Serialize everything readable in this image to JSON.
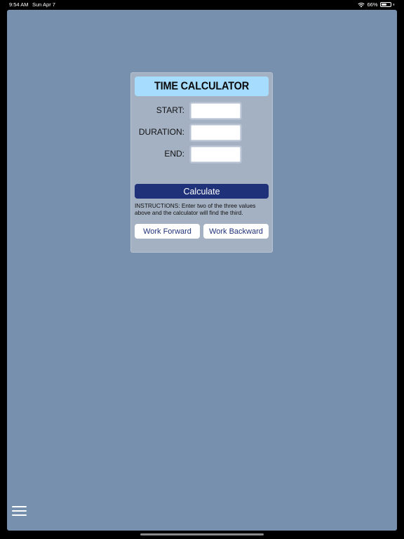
{
  "status_bar": {
    "time": "9:54 AM",
    "date": "Sun Apr 7",
    "battery_text": "66%",
    "battery_level": 0.66,
    "icons": [
      "wifi-icon",
      "battery-icon"
    ]
  },
  "colors": {
    "screen_background": "#7790ad",
    "panel_background": "#a4b1c3",
    "header_background": "#a6dcfd",
    "primary_button": "#1f3178"
  },
  "calculator": {
    "title": "TIME CALCULATOR",
    "fields": [
      {
        "label": "START:",
        "value": "",
        "placeholder": ""
      },
      {
        "label": "DURATION:",
        "value": "",
        "placeholder": ""
      },
      {
        "label": "END:",
        "value": "",
        "placeholder": ""
      }
    ],
    "calculate_label": "Calculate",
    "instructions": "INSTRUCTIONS:  Enter two of the three values above and the calculator will find the third.",
    "work_forward_label": "Work Forward",
    "work_backward_label": "Work Backward"
  },
  "menu": {
    "icon": "hamburger-menu-icon"
  }
}
